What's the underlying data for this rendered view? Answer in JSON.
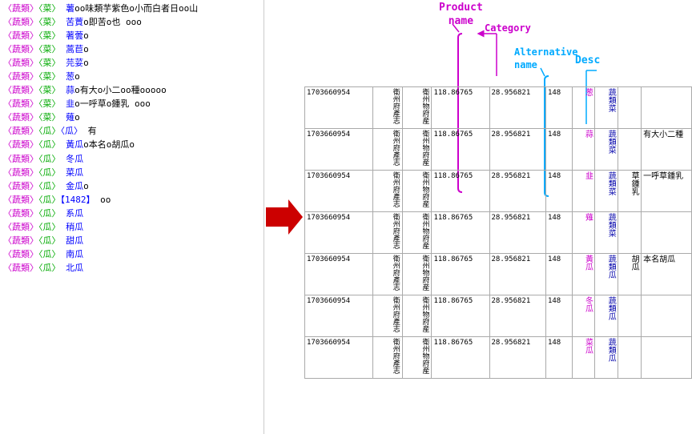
{
  "annotations": {
    "product_name_line1": "Product",
    "product_name_line2": "name",
    "category_label": "Category",
    "altname_line1": "Alternative",
    "altname_line2": "name",
    "desc_label": "Desc"
  },
  "left_list": [
    {
      "cat1": "蔬類",
      "cat2": "菜",
      "name": "薯",
      "detail": "oo味類芋紫色o小而白者日oo山"
    },
    {
      "cat1": "蔬類",
      "cat2": "菜",
      "name": "苦蕒",
      "detail": "o即苦o也 ooo"
    },
    {
      "cat1": "蔬類",
      "cat2": "菜",
      "name": "著蕓",
      "detail": "o"
    },
    {
      "cat1": "蔬類",
      "cat2": "菜",
      "name": "蒿苣",
      "detail": "o"
    },
    {
      "cat1": "蔬類",
      "cat2": "菜",
      "name": "芫荽",
      "detail": "o"
    },
    {
      "cat1": "蔬類",
      "cat2": "菜",
      "name": "葱",
      "detail": "o"
    },
    {
      "cat1": "蔬類",
      "cat2": "菜",
      "name": "蒜",
      "detail": "o有大o小二oo種ooooo"
    },
    {
      "cat1": "蔬類",
      "cat2": "菜",
      "name": "韭",
      "detail": "o一呼草o鍾乳 ooo"
    },
    {
      "cat1": "蔬類",
      "cat2": "菜",
      "name": "薙",
      "detail": "o"
    },
    {
      "cat1": "蔬類",
      "cat2": "瓜",
      "name": "〈瓜〉",
      "detail": "有"
    },
    {
      "cat1": "蔬類",
      "cat2": "瓜",
      "name": "黃瓜",
      "detail": "o本名o胡瓜o"
    },
    {
      "cat1": "蔬類",
      "cat2": "瓜",
      "name": "冬瓜",
      "detail": ""
    },
    {
      "cat1": "蔬類",
      "cat2": "瓜",
      "name": "菜瓜",
      "detail": ""
    },
    {
      "cat1": "蔬類",
      "cat2": "瓜",
      "name": "金瓜",
      "detail": "o"
    },
    {
      "cat1": "蔬類",
      "cat2": "瓜",
      "name": "【1482】",
      "detail": "oo"
    },
    {
      "cat1": "蔬類",
      "cat2": "瓜",
      "name": "系瓜",
      "detail": ""
    },
    {
      "cat1": "蔬類",
      "cat2": "瓜",
      "name": "稍瓜",
      "detail": ""
    },
    {
      "cat1": "蔬類",
      "cat2": "瓜",
      "name": "甜瓜",
      "detail": ""
    },
    {
      "cat1": "蔬類",
      "cat2": "瓜",
      "name": "南瓜",
      "detail": ""
    },
    {
      "cat1": "蔬類",
      "cat2": "瓜",
      "name": "北瓜",
      "detail": ""
    }
  ],
  "table_rows": [
    {
      "id": "1703660954",
      "pub1": "衛州府產志",
      "pub2": "衛州物府産",
      "lon": "118.86765",
      "lat": "28.956821",
      "num": "148",
      "product": "葱",
      "cat": "蔬類菜",
      "altname": "",
      "desc": ""
    },
    {
      "id": "1703660954",
      "pub1": "衛州府產志",
      "pub2": "衛州物府産",
      "lon": "118.86765",
      "lat": "28.956821",
      "num": "148",
      "product": "蒜",
      "cat": "蔬類菜",
      "altname": "",
      "desc": "有大小二種"
    },
    {
      "id": "1703660954",
      "pub1": "衛州府產志",
      "pub2": "衛州物府産",
      "lon": "118.86765",
      "lat": "28.956821",
      "num": "148",
      "product": "韭",
      "cat": "蔬類菜",
      "altname": "草鍾乳",
      "desc": "一呼草鍾乳"
    },
    {
      "id": "1703660954",
      "pub1": "衛州府產志",
      "pub2": "衛州物府産",
      "lon": "118.86765",
      "lat": "28.956821",
      "num": "148",
      "product": "薙",
      "cat": "蔬類菜",
      "altname": "",
      "desc": ""
    },
    {
      "id": "1703660954",
      "pub1": "衛州府產志",
      "pub2": "衛州物府産",
      "lon": "118.86765",
      "lat": "28.956821",
      "num": "148",
      "product": "黃瓜",
      "cat": "蔬類瓜",
      "altname": "胡瓜",
      "desc": "本名胡瓜"
    },
    {
      "id": "1703660954",
      "pub1": "衛州府產志",
      "pub2": "衛州物府産",
      "lon": "118.86765",
      "lat": "28.956821",
      "num": "148",
      "product": "冬瓜",
      "cat": "蔬類瓜",
      "altname": "",
      "desc": ""
    },
    {
      "id": "1703660954",
      "pub1": "衛州府產志",
      "pub2": "衛州物府産",
      "lon": "118.86765",
      "lat": "28.956821",
      "num": "148",
      "product": "菜瓜",
      "cat": "蔬類瓜",
      "altname": "",
      "desc": ""
    }
  ]
}
